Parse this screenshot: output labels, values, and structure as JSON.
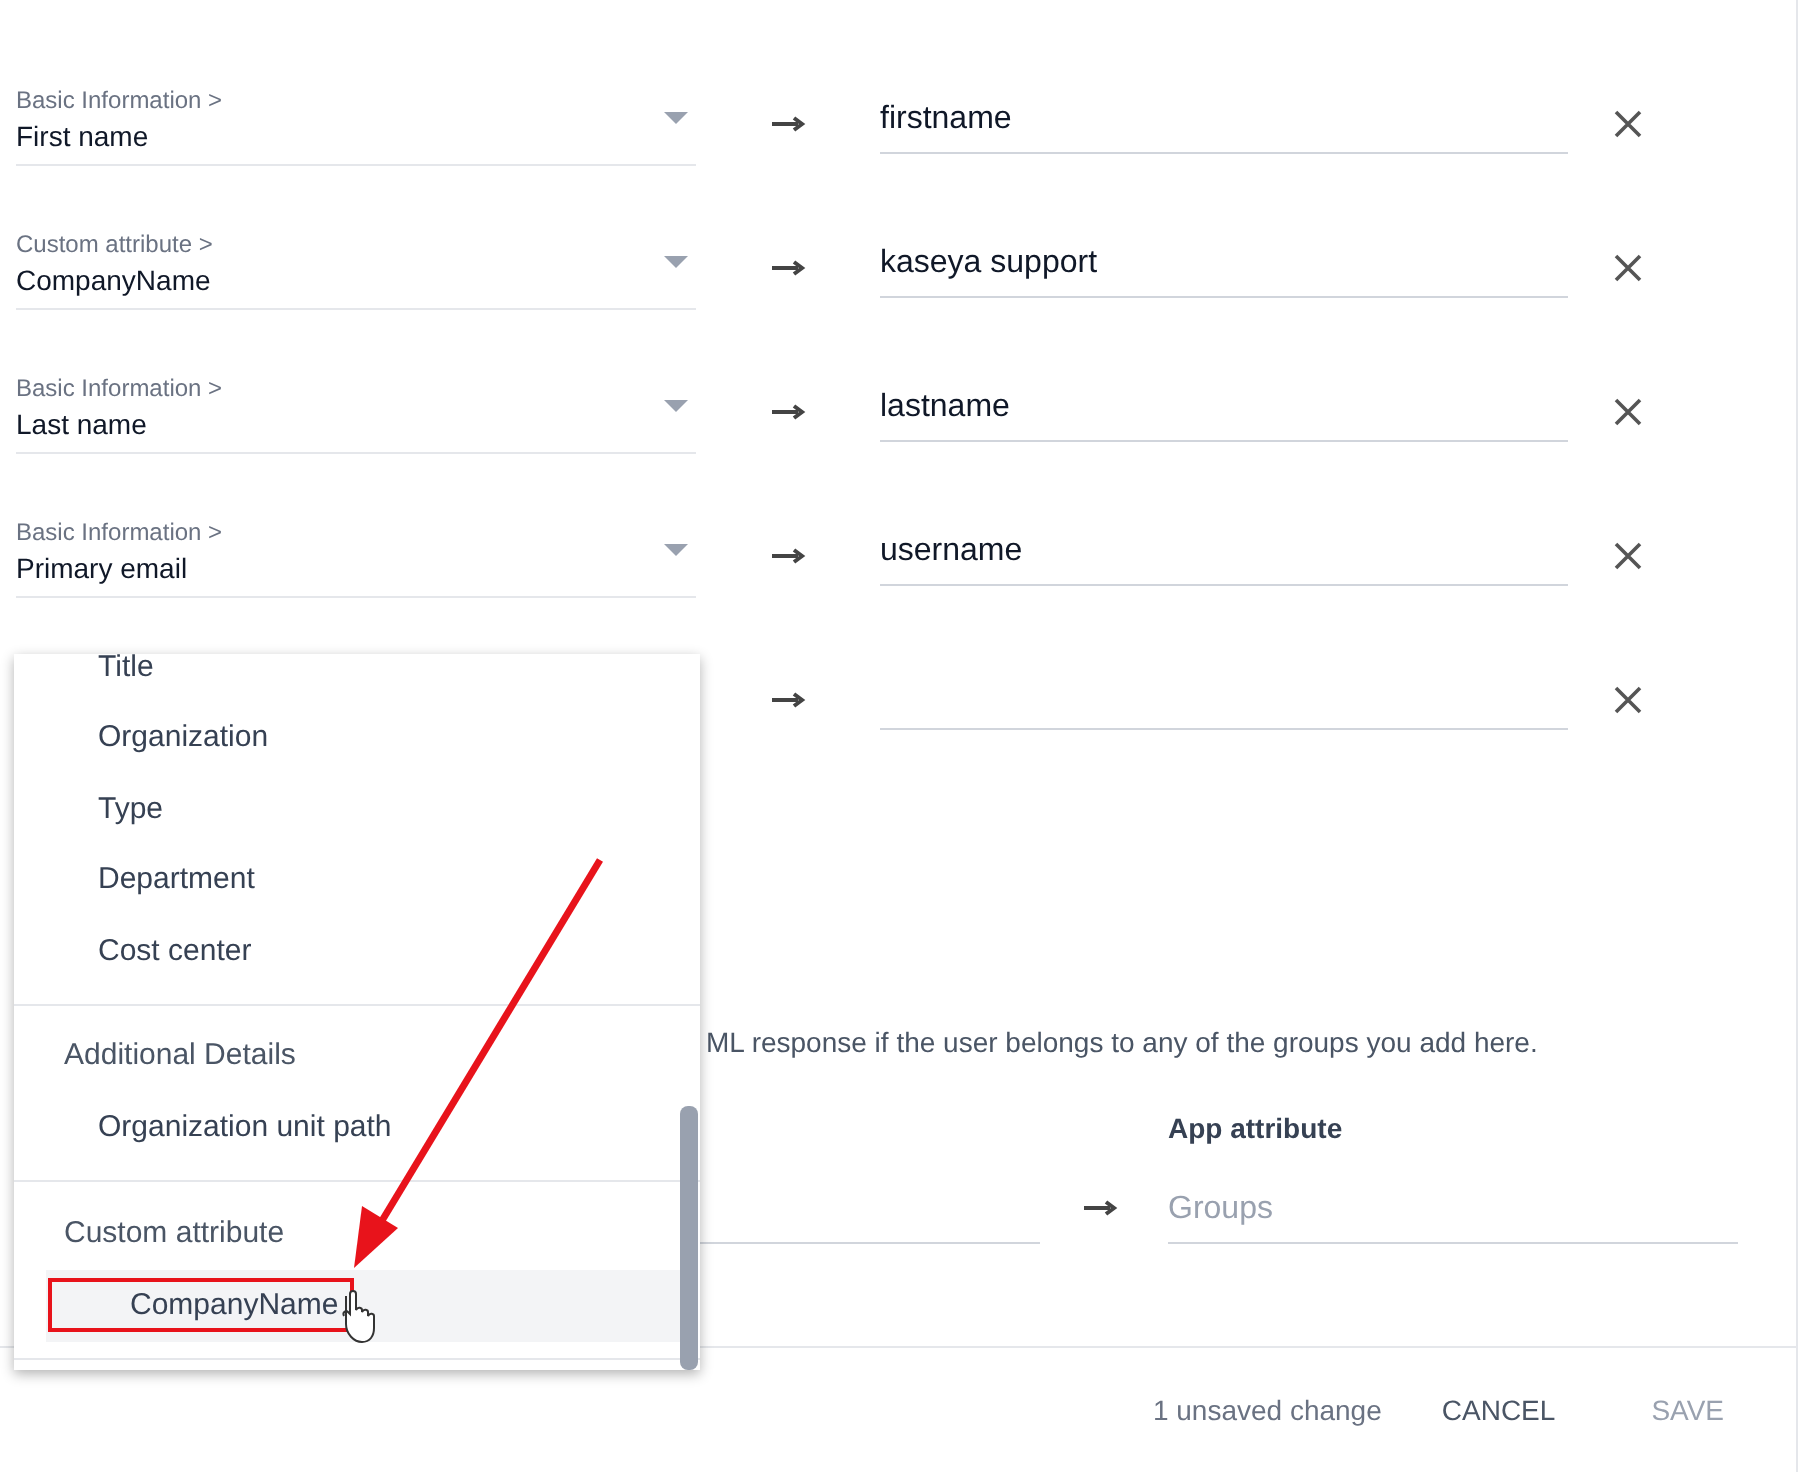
{
  "mappings": [
    {
      "kind": "filled",
      "category": "Basic Information >",
      "value": "First name",
      "app_attribute": "firstname"
    },
    {
      "kind": "filled",
      "category": "Custom attribute >",
      "value": "CompanyName",
      "app_attribute": "kaseya support"
    },
    {
      "kind": "filled",
      "category": "Basic Information >",
      "value": "Last name",
      "app_attribute": "lastname"
    },
    {
      "kind": "filled",
      "category": "Basic Information >",
      "value": "Primary email",
      "app_attribute": "username"
    },
    {
      "kind": "open"
    }
  ],
  "dropdown": {
    "groups": [
      {
        "items": [
          {
            "label": "Title",
            "selected": false
          },
          {
            "label": "Organization",
            "selected": false
          },
          {
            "label": "Type",
            "selected": false
          },
          {
            "label": "Department",
            "selected": false
          },
          {
            "label": "Cost center",
            "selected": false
          }
        ]
      },
      {
        "header": "Additional Details",
        "items": [
          {
            "label": "Organization unit path",
            "selected": false
          }
        ]
      },
      {
        "header": "Custom attribute",
        "items": [
          {
            "label": "CompanyName",
            "selected": true
          }
        ]
      }
    ]
  },
  "groups": {
    "description": "ML response if the user belongs to any of the groups you add here.",
    "app_attribute_label": "App attribute",
    "app_attribute_placeholder": "Groups"
  },
  "footer": {
    "status": "1 unsaved change",
    "buttons": [
      {
        "label": "CANCEL",
        "disabled": false
      },
      {
        "label": "SAVE",
        "disabled": true
      }
    ]
  }
}
